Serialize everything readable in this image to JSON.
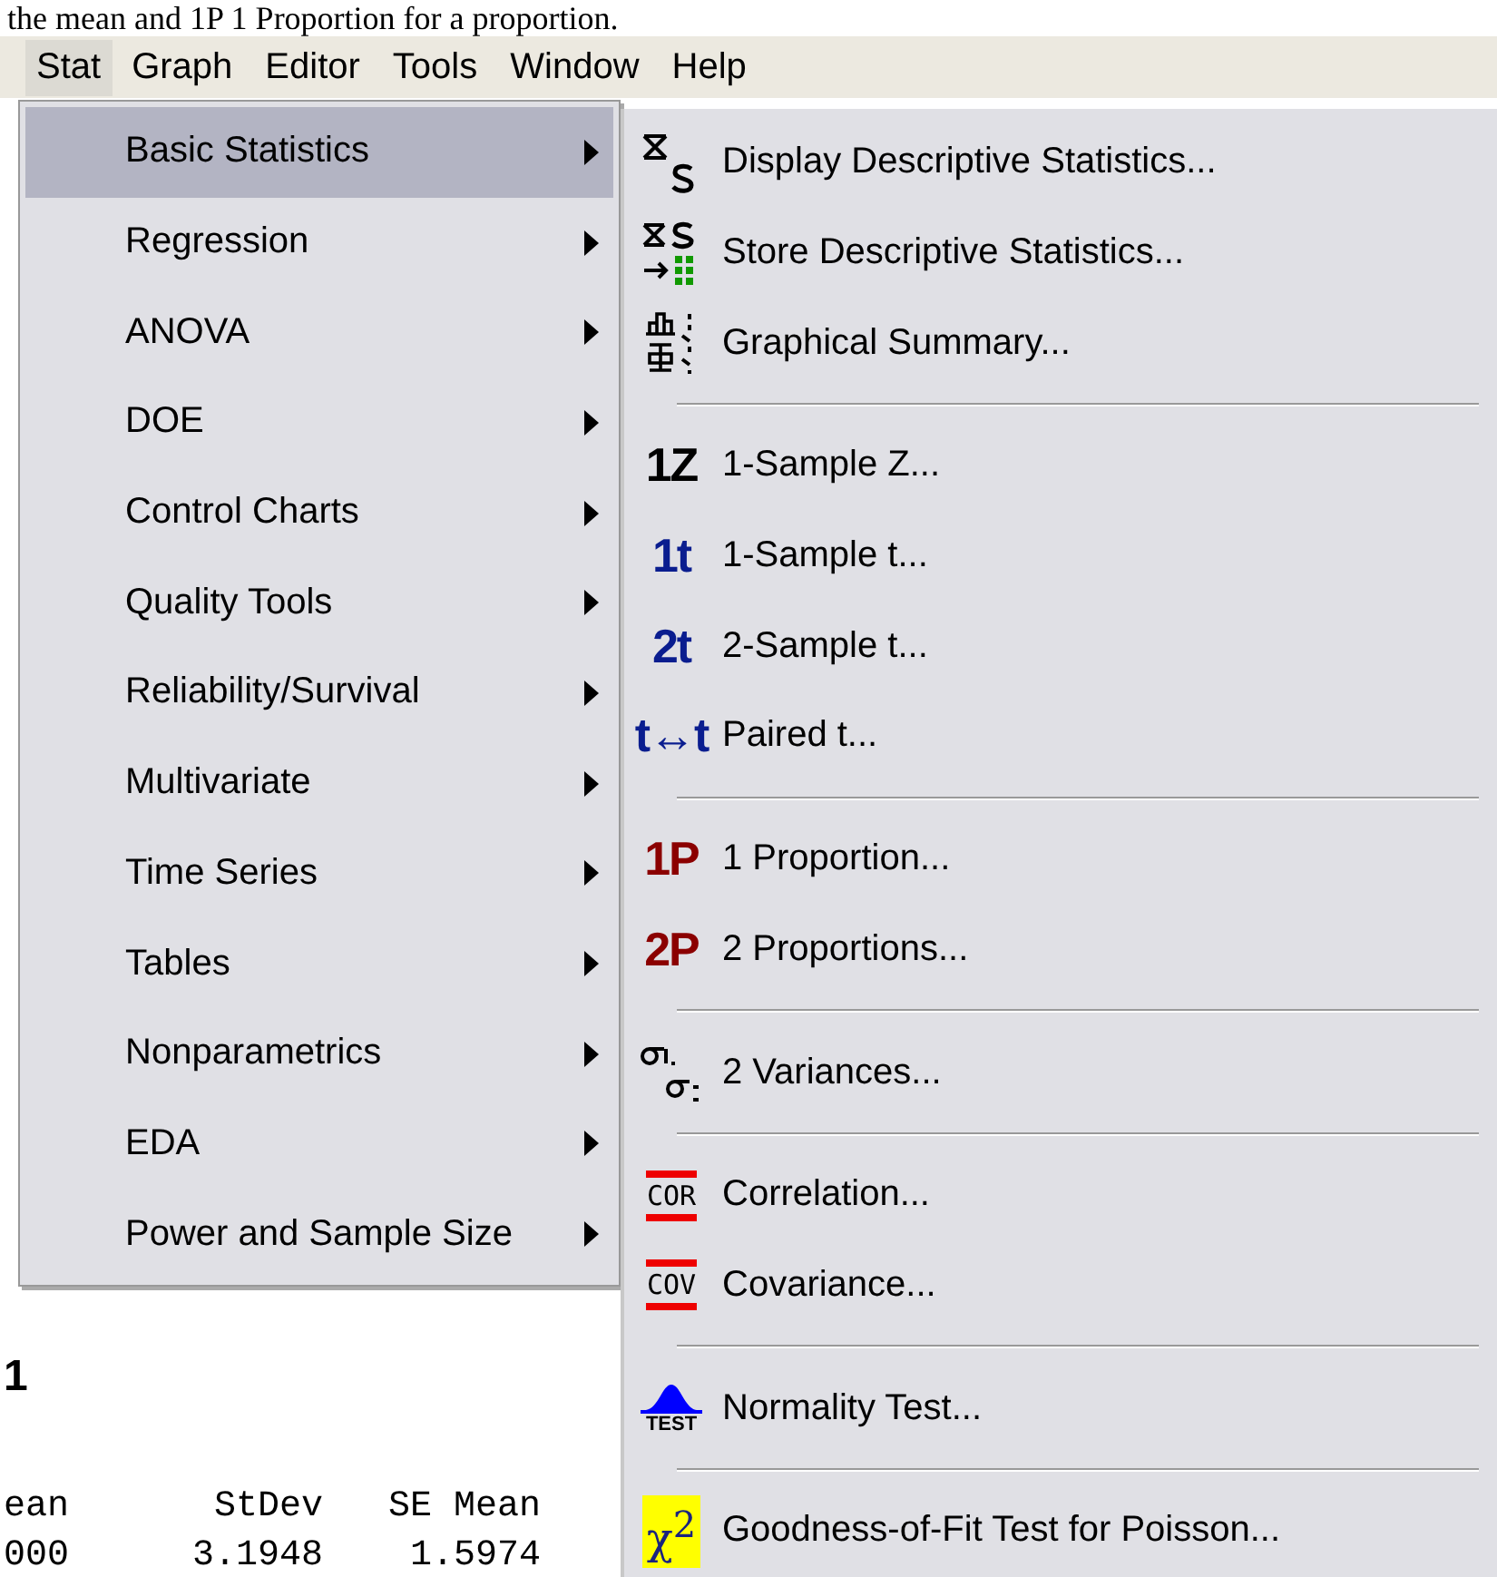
{
  "top_text": "the mean and 1P 1 Proportion for a proportion.",
  "menubar": [
    {
      "label": "Stat",
      "selected": true
    },
    {
      "label": "Graph",
      "selected": false
    },
    {
      "label": "Editor",
      "selected": false
    },
    {
      "label": "Tools",
      "selected": false
    },
    {
      "label": "Window",
      "selected": false
    },
    {
      "label": "Help",
      "selected": false
    }
  ],
  "stat_menu": [
    {
      "label": "Basic Statistics",
      "submenu": true,
      "selected": true
    },
    {
      "label": "Regression",
      "submenu": true,
      "selected": false
    },
    {
      "label": "ANOVA",
      "submenu": true,
      "selected": false
    },
    {
      "label": "DOE",
      "submenu": true,
      "selected": false
    },
    {
      "label": "Control Charts",
      "submenu": true,
      "selected": false
    },
    {
      "label": "Quality Tools",
      "submenu": true,
      "selected": false
    },
    {
      "label": "Reliability/Survival",
      "submenu": true,
      "selected": false
    },
    {
      "label": "Multivariate",
      "submenu": true,
      "selected": false
    },
    {
      "label": "Time Series",
      "submenu": true,
      "selected": false
    },
    {
      "label": "Tables",
      "submenu": true,
      "selected": false
    },
    {
      "label": "Nonparametrics",
      "submenu": true,
      "selected": false
    },
    {
      "label": "EDA",
      "submenu": true,
      "selected": false
    },
    {
      "label": "Power and Sample Size",
      "submenu": true,
      "selected": false
    }
  ],
  "basic_statistics_menu": [
    [
      {
        "label": "Display Descriptive Statistics...",
        "icon": {
          "kind": "xs"
        }
      },
      {
        "label": "Store Descriptive Statistics...",
        "icon": {
          "kind": "store"
        }
      },
      {
        "label": "Graphical Summary...",
        "icon": {
          "kind": "summary"
        }
      }
    ],
    [
      {
        "label": "1-Sample Z...",
        "icon": {
          "kind": "glyph",
          "text": "1Z",
          "color": "#000000"
        }
      },
      {
        "label": "1-Sample t...",
        "icon": {
          "kind": "glyph",
          "text": "1t",
          "color": "#0a1d8f"
        }
      },
      {
        "label": "2-Sample t...",
        "icon": {
          "kind": "glyph",
          "text": "2t",
          "color": "#0a1d8f"
        }
      },
      {
        "label": "Paired t...",
        "icon": {
          "kind": "glyph",
          "text": "t↔t",
          "color": "#0a1d8f"
        }
      }
    ],
    [
      {
        "label": "1 Proportion...",
        "icon": {
          "kind": "glyph",
          "text": "1P",
          "color": "#8b0000"
        }
      },
      {
        "label": "2 Proportions...",
        "icon": {
          "kind": "glyph",
          "text": "2P",
          "color": "#8b0000"
        }
      }
    ],
    [
      {
        "label": "2 Variances...",
        "icon": {
          "kind": "variance"
        }
      }
    ],
    [
      {
        "label": "Correlation...",
        "icon": {
          "kind": "boxed",
          "text": "COR"
        }
      },
      {
        "label": "Covariance...",
        "icon": {
          "kind": "boxed",
          "text": "COV"
        }
      }
    ],
    [
      {
        "label": "Normality Test...",
        "icon": {
          "kind": "normal",
          "text": "TEST"
        }
      }
    ],
    [
      {
        "label": "Goodness-of-Fit Test for Poisson...",
        "icon": {
          "kind": "chi",
          "text": "χ$^{2}$"
        }
      }
    ]
  ],
  "session": {
    "heading": "1",
    "columns": [
      "ean",
      "StDev",
      "SE Mean"
    ],
    "row": [
      "000",
      "3.1948",
      "1.5974"
    ]
  }
}
